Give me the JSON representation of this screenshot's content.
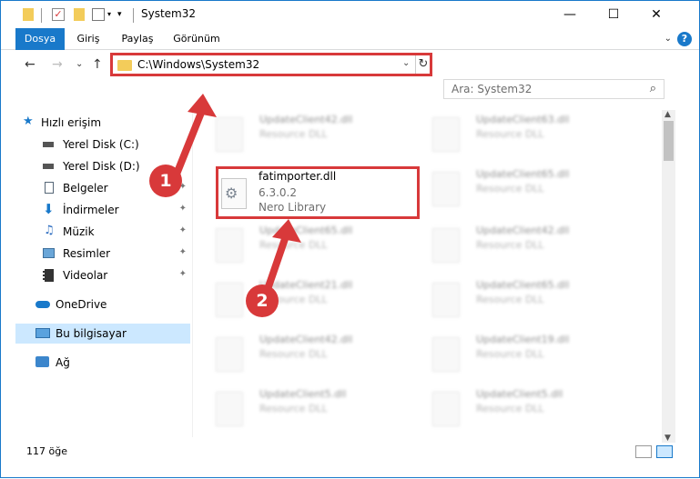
{
  "window": {
    "title": "System32",
    "minimize": "—",
    "maximize": "☐",
    "close": "✕"
  },
  "ribbon": {
    "tabs": [
      "Dosya",
      "Giriş",
      "Paylaş",
      "Görünüm"
    ],
    "help": "?",
    "expand": "⌄"
  },
  "nav": {
    "back": "←",
    "forward": "→",
    "recent": "⌄",
    "up": "↑"
  },
  "address": {
    "path": "C:\\Windows\\System32",
    "dropdown": "⌄",
    "refresh": "↻"
  },
  "search": {
    "placeholder": "Ara: System32",
    "icon": "⌕"
  },
  "sidebar": {
    "items": [
      {
        "label": "Hızlı erişim",
        "icon": "star-icon",
        "pinned": false
      },
      {
        "label": "Yerel Disk (C:)",
        "icon": "drive-icon",
        "pinned": false
      },
      {
        "label": "Yerel Disk (D:)",
        "icon": "drive-icon",
        "pinned": false
      },
      {
        "label": "Belgeler",
        "icon": "documents-icon",
        "pinned": true
      },
      {
        "label": "İndirmeler",
        "icon": "downloads-icon",
        "pinned": true
      },
      {
        "label": "Müzik",
        "icon": "music-icon",
        "pinned": true
      },
      {
        "label": "Resimler",
        "icon": "pictures-icon",
        "pinned": true
      },
      {
        "label": "Videolar",
        "icon": "videos-icon",
        "pinned": true
      },
      {
        "label": "OneDrive",
        "icon": "cloud-icon",
        "pinned": false
      },
      {
        "label": "Bu bilgisayar",
        "icon": "computer-icon",
        "pinned": false,
        "selected": true
      },
      {
        "label": "Ağ",
        "icon": "network-icon",
        "pinned": false
      }
    ],
    "pin_glyph": "✦"
  },
  "files": {
    "background_items": [
      {
        "name": "UpdateClient42.dll",
        "desc": "Resource DLL"
      },
      {
        "name": "UpdateClient63.dll",
        "desc": "Resource DLL"
      },
      {
        "name": "UpdateClient65.dll",
        "desc": "Resource DLL"
      },
      {
        "name": "UpdateClient65.dll",
        "desc": "Resource DLL"
      },
      {
        "name": "UpdateClient42.dll",
        "desc": "Resource DLL"
      },
      {
        "name": "UpdateClient21.dll",
        "desc": "Resource DLL"
      },
      {
        "name": "UpdateClient65.dll",
        "desc": "Resource DLL"
      },
      {
        "name": "UpdateClient42.dll",
        "desc": "Resource DLL"
      },
      {
        "name": "UpdateClient19.dll",
        "desc": "Resource DLL"
      },
      {
        "name": "UpdateClient5.dll",
        "desc": "Resource DLL"
      },
      {
        "name": "UpdateClient5.dll",
        "desc": "Resource DLL"
      }
    ],
    "highlighted": {
      "name": "fatimporter.dll",
      "version": "6.3.0.2",
      "desc": "Nero Library"
    }
  },
  "status": {
    "count": "117 öğe"
  },
  "annotations": {
    "step1": "1",
    "step2": "2",
    "color": "#d8393a"
  },
  "colors": {
    "accent": "#1979ca",
    "selection": "#cce8ff",
    "highlight_border": "#d8393a"
  }
}
